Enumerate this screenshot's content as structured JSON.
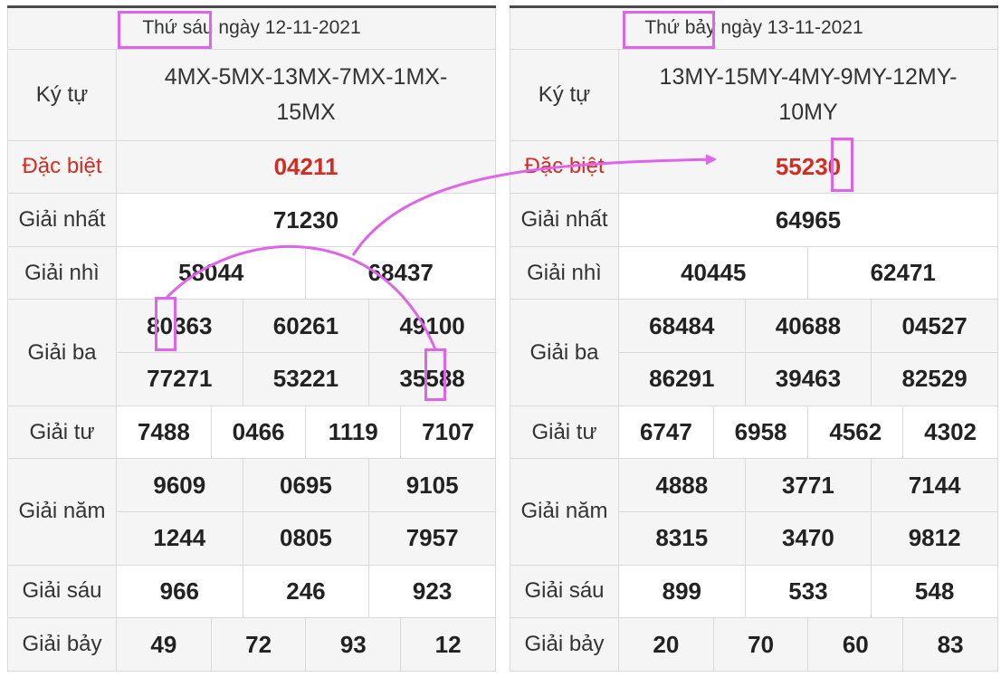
{
  "left": {
    "header_day": "Thứ sáu",
    "header_date": " ngày 12-11-2021",
    "ky_tu_label": "Ký tự",
    "ky_tu_line1": "4MX-5MX-13MX-7MX-1MX-",
    "ky_tu_line2": "15MX",
    "dac_biet_label": "Đặc biệt",
    "dac_biet": "04211",
    "nhat_label": "Giải nhất",
    "nhat": "71230",
    "nhi_label": "Giải nhì",
    "nhi": [
      "58044",
      "68437"
    ],
    "ba_label": "Giải ba",
    "ba": [
      "80363",
      "60261",
      "49100",
      "77271",
      "53221",
      "35588"
    ],
    "tu_label": "Giải tư",
    "tu": [
      "7488",
      "0466",
      "1119",
      "7107"
    ],
    "nam_label": "Giải năm",
    "nam": [
      "9609",
      "0695",
      "9105",
      "1244",
      "0805",
      "7957"
    ],
    "sau_label": "Giải sáu",
    "sau": [
      "966",
      "246",
      "923"
    ],
    "bay_label": "Giải bảy",
    "bay": [
      "49",
      "72",
      "93",
      "12"
    ]
  },
  "right": {
    "header_day": "Thứ bảy",
    "header_date": " ngày 13-11-2021",
    "ky_tu_label": "Ký tự",
    "ky_tu_line1": "13MY-15MY-4MY-9MY-12MY-",
    "ky_tu_line2": "10MY",
    "dac_biet_label": "Đặc biệt",
    "dac_biet": "55230",
    "nhat_label": "Giải nhất",
    "nhat": "64965",
    "nhi_label": "Giải nhì",
    "nhi": [
      "40445",
      "62471"
    ],
    "ba_label": "Giải ba",
    "ba": [
      "68484",
      "40688",
      "04527",
      "86291",
      "39463",
      "82529"
    ],
    "tu_label": "Giải tư",
    "tu": [
      "6747",
      "6958",
      "4562",
      "4302"
    ],
    "nam_label": "Giải năm",
    "nam": [
      "4888",
      "3771",
      "7144",
      "8315",
      "3470",
      "9812"
    ],
    "sau_label": "Giải sáu",
    "sau": [
      "899",
      "533",
      "548"
    ],
    "bay_label": "Giải bảy",
    "bay": [
      "20",
      "70",
      "60",
      "83"
    ]
  },
  "colors": {
    "highlight": "#e064e9",
    "special_prize": "#d32c23",
    "header_border": "#4a4a4a"
  }
}
